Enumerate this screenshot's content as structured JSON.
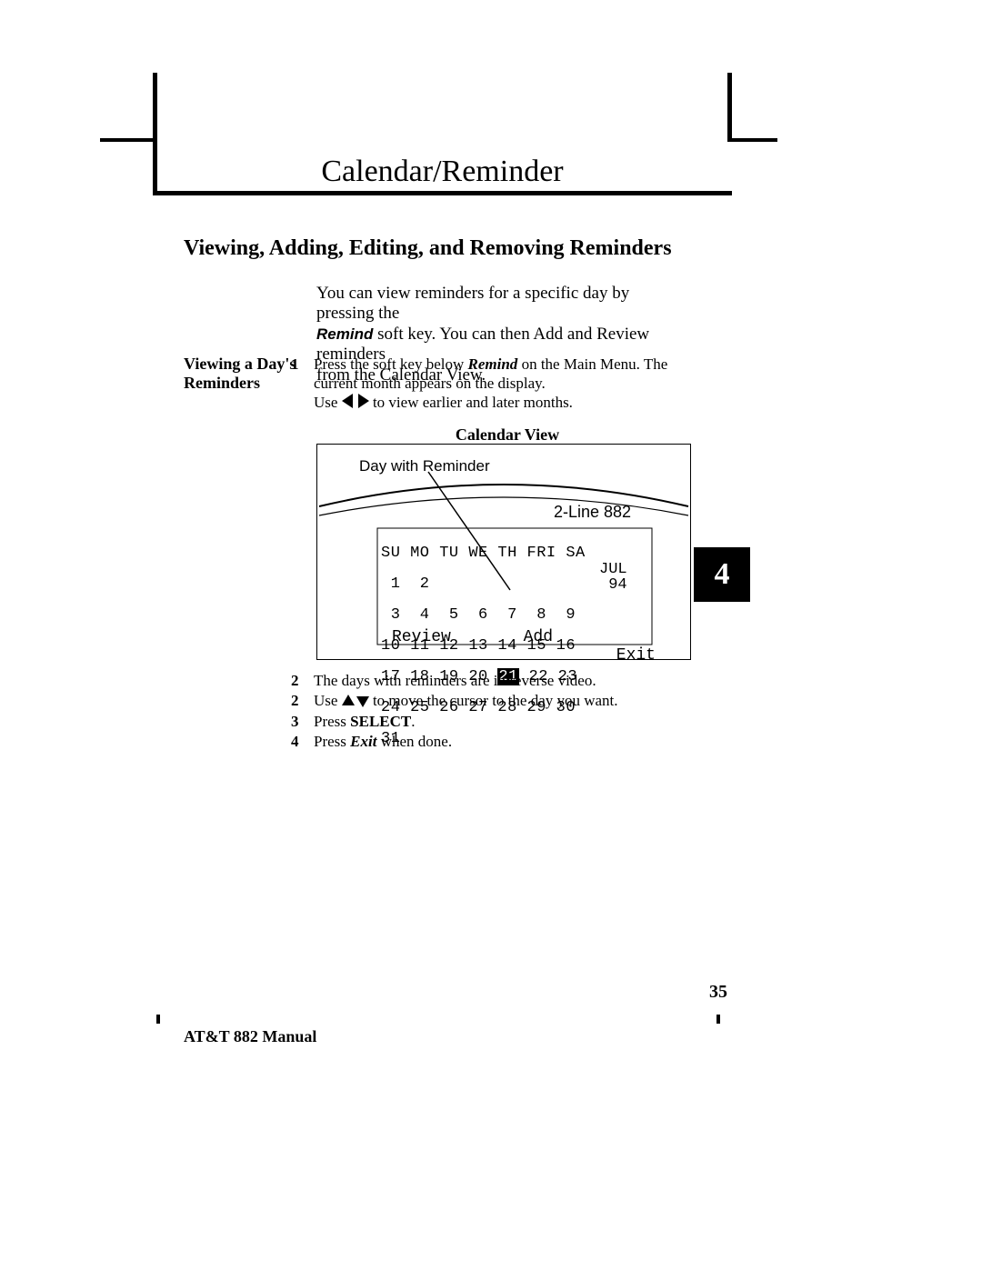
{
  "header": {
    "title": "Calendar/Reminder"
  },
  "section": {
    "title": "Viewing, Adding, Editing, and Removing Reminders"
  },
  "intro": {
    "line1": "You can view reminders for a specific day by pressing the",
    "remind_word": "Remind",
    "line2_rest": " soft key. You can then Add and Review reminders",
    "line3": "from the Calendar View."
  },
  "side_label": {
    "l1": "Viewing a Day's",
    "l2": "Reminders"
  },
  "steps": {
    "s1": {
      "num": "1",
      "a": "Press the soft key below ",
      "remind": "Remind",
      "b": " on the Main Menu.  The",
      "c": "current month appears on the display."
    },
    "use_line": {
      "a": "Use ",
      "b": " to view earlier and later months."
    },
    "cal_view_label": "Calendar View",
    "s2a": {
      "num": "2",
      "text": "The days with reminders are in reverse video."
    },
    "s2b": {
      "num": "2",
      "a": "Use ",
      "b": " to move the cursor to the day you want."
    },
    "s3": {
      "num": "3",
      "a": "Press ",
      "select": "SELECT",
      "b": "."
    },
    "s4": {
      "num": "4",
      "a": "Press ",
      "exit": "Exit",
      "b": " when done."
    }
  },
  "diagram": {
    "callout": "Day with Reminder",
    "device": "2-Line 882",
    "days_header": "SU MO TU WE TH FRI SA",
    "rows": [
      " 1  2",
      " 3  4  5  6  7  8  9",
      "10 11 12 13 14 15 16",
      "17 18 19 20 21 22 23",
      "24 25 26 27 28 29 30",
      "31"
    ],
    "highlight_day": "21",
    "month": "JUL",
    "year": "94",
    "softkeys": {
      "left": "Review",
      "mid": "Add",
      "right": "Exit"
    }
  },
  "chapter_tab": "4",
  "page_number": "35",
  "footer": "AT&T 882 Manual"
}
